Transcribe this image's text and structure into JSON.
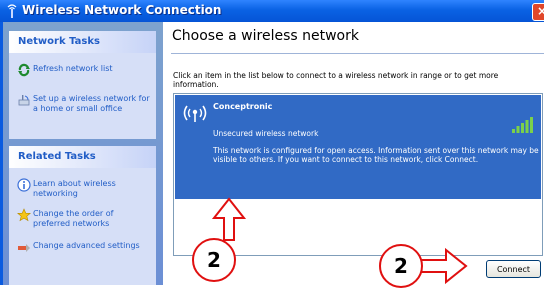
{
  "window": {
    "title": "Wireless Network Connection",
    "close_glyph": "×"
  },
  "sidebar": {
    "network_tasks": {
      "heading": "Network Tasks",
      "items": [
        {
          "label": "Refresh network list",
          "icon": "refresh-icon"
        },
        {
          "label": "Set up a wireless network for a home or small office",
          "icon": "setup-network-icon"
        }
      ]
    },
    "related_tasks": {
      "heading": "Related Tasks",
      "items": [
        {
          "label": "Learn about wireless networking",
          "icon": "info-icon"
        },
        {
          "label": "Change the order of preferred networks",
          "icon": "star-icon"
        },
        {
          "label": "Change advanced settings",
          "icon": "settings-icon"
        }
      ]
    }
  },
  "main": {
    "title": "Choose a wireless network",
    "instruction": "Click an item in the list below to connect to a wireless network in range or to get more information.",
    "networks": [
      {
        "name": "Conceptronic",
        "security": "Unsecured wireless network",
        "description": "This network is configured for open access. Information sent over this network may be visible to others. If you want to connect to this network, click Connect.",
        "signal_bars": 5,
        "selected": true
      }
    ],
    "connect_label": "Connect"
  },
  "annotations": {
    "callout_left": "2",
    "callout_right": "2",
    "color": "#e01010"
  },
  "colors": {
    "title_bar": "#0a62e4",
    "selection": "#316ac5",
    "task_link": "#215dc6",
    "sidebar": "#6c8fd5"
  }
}
